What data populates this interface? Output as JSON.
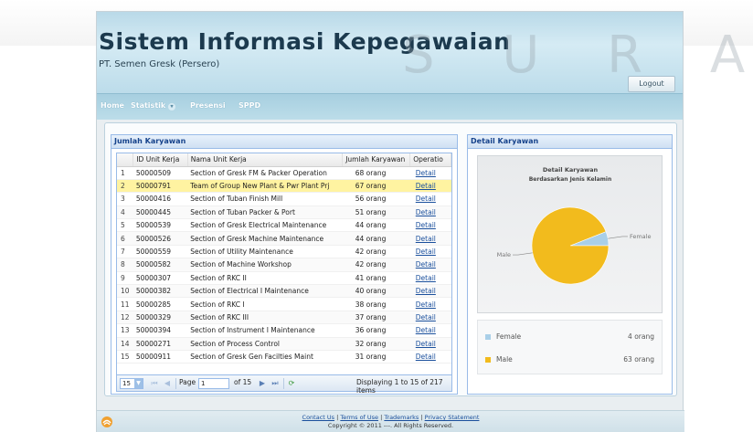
{
  "watermark": "S U R A B A Y A",
  "app": {
    "title": "Sistem Informasi Kepegawaian",
    "subtitle": "PT. Semen Gresk (Persero)",
    "logout_label": "Logout"
  },
  "menu": {
    "home": "Home",
    "statistik": "Statistik",
    "presensi": "Presensi",
    "sppd": "SPPD"
  },
  "grid": {
    "title": "Jumlah Karyawan",
    "columns": [
      "",
      "ID Unit Kerja",
      "Nama Unit Kerja",
      "Jumlah Karyawan",
      "Operatio"
    ],
    "rows": [
      {
        "no": "1",
        "id": "50000509",
        "name": "Section of Gresk FM & Packer Operation",
        "count": "68 orang",
        "op": "Detail"
      },
      {
        "no": "2",
        "id": "50000791",
        "name": "Team of Group New Plant & Pwr Plant Prj",
        "count": "67 orang",
        "op": "Detail"
      },
      {
        "no": "3",
        "id": "50000416",
        "name": "Section of Tuban Finish Mill",
        "count": "56 orang",
        "op": "Detail"
      },
      {
        "no": "4",
        "id": "50000445",
        "name": "Section of Tuban Packer & Port",
        "count": "51 orang",
        "op": "Detail"
      },
      {
        "no": "5",
        "id": "50000539",
        "name": "Section of Gresk Electrical Maintenance",
        "count": "44 orang",
        "op": "Detail"
      },
      {
        "no": "6",
        "id": "50000526",
        "name": "Section of Gresk Machine Maintenance",
        "count": "44 orang",
        "op": "Detail"
      },
      {
        "no": "7",
        "id": "50000559",
        "name": "Section of Utility Maintenance",
        "count": "42 orang",
        "op": "Detail"
      },
      {
        "no": "8",
        "id": "50000582",
        "name": "Section of Machine Workshop",
        "count": "42 orang",
        "op": "Detail"
      },
      {
        "no": "9",
        "id": "50000307",
        "name": "Section of RKC II",
        "count": "41 orang",
        "op": "Detail"
      },
      {
        "no": "10",
        "id": "50000382",
        "name": "Section of Electrical I Maintenance",
        "count": "40 orang",
        "op": "Detail"
      },
      {
        "no": "11",
        "id": "50000285",
        "name": "Section of RKC I",
        "count": "38 orang",
        "op": "Detail"
      },
      {
        "no": "12",
        "id": "50000329",
        "name": "Section of RKC III",
        "count": "37 orang",
        "op": "Detail"
      },
      {
        "no": "13",
        "id": "50000394",
        "name": "Section of Instrument I Maintenance",
        "count": "36 orang",
        "op": "Detail"
      },
      {
        "no": "14",
        "id": "50000271",
        "name": "Section of Process Control",
        "count": "32 orang",
        "op": "Detail"
      },
      {
        "no": "15",
        "id": "50000911",
        "name": "Section of Gresk Gen Facilties Maint",
        "count": "31 orang",
        "op": "Detail"
      }
    ],
    "selected_row": 1,
    "pager": {
      "page_size": "15",
      "page_label": "Page",
      "page_value": "1",
      "of_label": "of 15",
      "display_text": "Displaying 1 to 15 of 217 items"
    }
  },
  "detail": {
    "title": "Detail Karyawan",
    "chart_title": "Detail Karyawan",
    "chart_subtitle": "Berdasarkan Jenis Kelamin"
  },
  "chart_data": {
    "type": "pie",
    "title": "Detail Karyawan",
    "subtitle": "Berdasarkan Jenis Kelamin",
    "slices": [
      {
        "label": "Female",
        "value": 4,
        "display": "4 orang",
        "color": "#a9cfe8"
      },
      {
        "label": "Male",
        "value": 63,
        "display": "63 orang",
        "color": "#f2bb1d"
      }
    ]
  },
  "footer": {
    "contact": "Contact Us",
    "terms": "Terms of Use",
    "trademarks": "Trademarks",
    "privacy": "Privacy Statement",
    "copyright": "Copyright © 2011 ---. All Rights Reserved."
  }
}
